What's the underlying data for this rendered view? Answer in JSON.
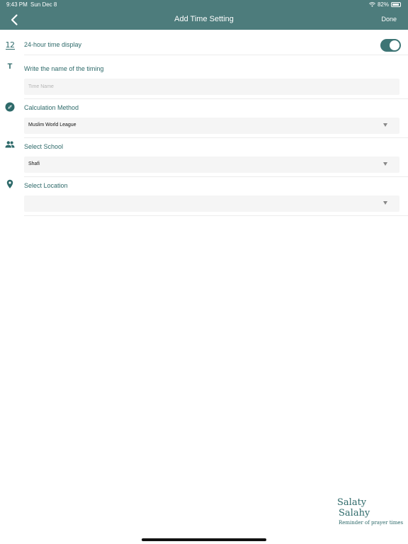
{
  "status_bar": {
    "time": "9:43 PM",
    "date": "Sun Dec 8",
    "battery": "82%"
  },
  "nav": {
    "title": "Add Time Setting",
    "done": "Done",
    "back_icon": "chevron-left-icon"
  },
  "colors": {
    "header": "#4d7c7c",
    "accent": "#2e6a6a",
    "field_bg": "#f5f5f5",
    "toggle_on": "#3e7575"
  },
  "rows": {
    "time_format": {
      "icon": "12",
      "label": "24-hour time display",
      "toggle_on": true
    },
    "name": {
      "icon": "T",
      "label": "Write the name of the timing",
      "placeholder": "Time Name",
      "value": ""
    },
    "method": {
      "icon": "compass-icon",
      "label": "Calculation Method",
      "value": "Muslim World League"
    },
    "school": {
      "icon": "people-icon",
      "label": "Select School",
      "value": "Shafi"
    },
    "location": {
      "icon": "location-pin-icon",
      "label": "Select Location",
      "value": ""
    }
  },
  "brand": {
    "line1": "Salaty",
    "line2": "Salahy",
    "tagline": "Reminder of prayer times"
  }
}
